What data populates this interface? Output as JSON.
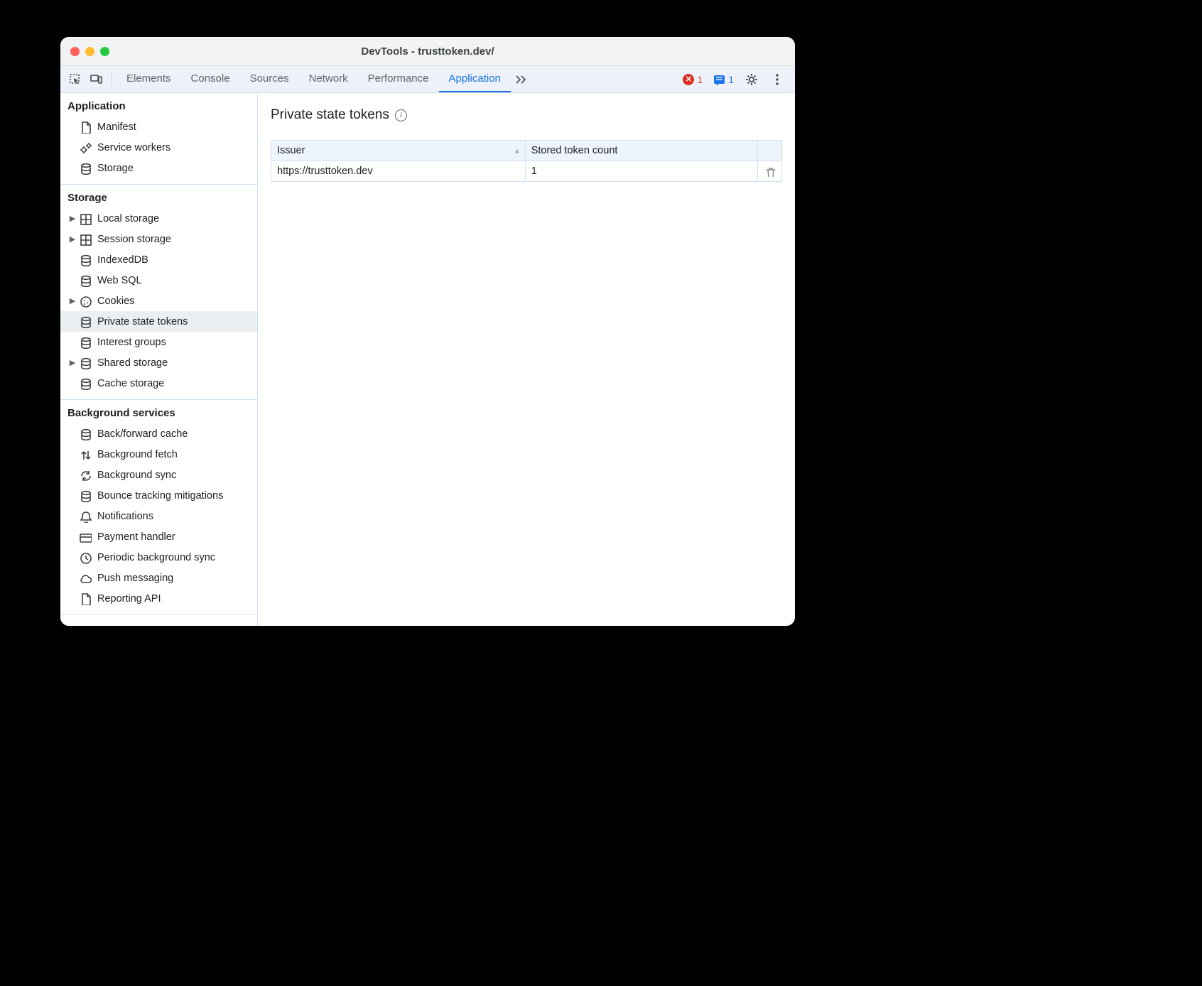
{
  "window": {
    "title": "DevTools - trusttoken.dev/"
  },
  "toolbar": {
    "tabs": [
      "Elements",
      "Console",
      "Sources",
      "Network",
      "Performance",
      "Application"
    ],
    "active_tab_index": 5,
    "error_count": "1",
    "issue_count": "1"
  },
  "sidebar": {
    "groups": [
      {
        "title": "Application",
        "items": [
          {
            "label": "Manifest",
            "icon": "file",
            "expandable": false
          },
          {
            "label": "Service workers",
            "icon": "gears",
            "expandable": false
          },
          {
            "label": "Storage",
            "icon": "db",
            "expandable": false
          }
        ]
      },
      {
        "title": "Storage",
        "items": [
          {
            "label": "Local storage",
            "icon": "table",
            "expandable": true
          },
          {
            "label": "Session storage",
            "icon": "table",
            "expandable": true
          },
          {
            "label": "IndexedDB",
            "icon": "db",
            "expandable": false
          },
          {
            "label": "Web SQL",
            "icon": "db",
            "expandable": false
          },
          {
            "label": "Cookies",
            "icon": "cookie",
            "expandable": true
          },
          {
            "label": "Private state tokens",
            "icon": "db",
            "expandable": false,
            "selected": true
          },
          {
            "label": "Interest groups",
            "icon": "db",
            "expandable": false
          },
          {
            "label": "Shared storage",
            "icon": "db",
            "expandable": true
          },
          {
            "label": "Cache storage",
            "icon": "db",
            "expandable": false
          }
        ]
      },
      {
        "title": "Background services",
        "items": [
          {
            "label": "Back/forward cache",
            "icon": "db",
            "expandable": false
          },
          {
            "label": "Background fetch",
            "icon": "updown",
            "expandable": false
          },
          {
            "label": "Background sync",
            "icon": "sync",
            "expandable": false
          },
          {
            "label": "Bounce tracking mitigations",
            "icon": "db",
            "expandable": false
          },
          {
            "label": "Notifications",
            "icon": "bell",
            "expandable": false
          },
          {
            "label": "Payment handler",
            "icon": "card",
            "expandable": false
          },
          {
            "label": "Periodic background sync",
            "icon": "clock",
            "expandable": false
          },
          {
            "label": "Push messaging",
            "icon": "cloud",
            "expandable": false
          },
          {
            "label": "Reporting API",
            "icon": "file",
            "expandable": false
          }
        ]
      }
    ]
  },
  "main": {
    "heading": "Private state tokens",
    "table": {
      "headers": [
        "Issuer",
        "Stored token count"
      ],
      "sorted_col": 0,
      "sorted_dir": "asc",
      "rows": [
        {
          "issuer": "https://trusttoken.dev",
          "count": "1"
        }
      ]
    }
  }
}
